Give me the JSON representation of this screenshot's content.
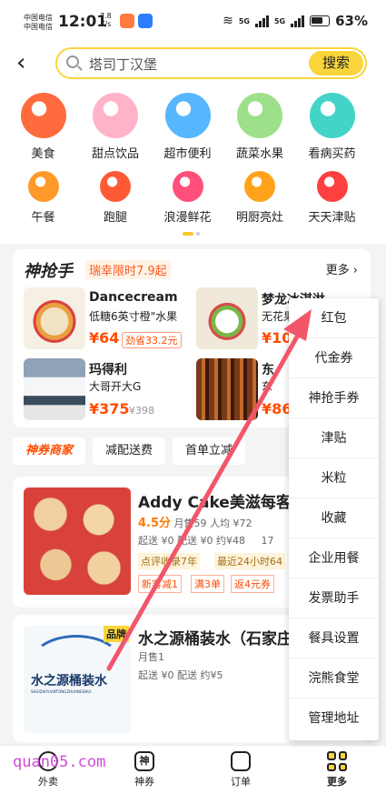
{
  "status": {
    "carrier_1": "中国电信",
    "carrier_2": "中国电信",
    "time": "12:01",
    "speed_value": "7.8",
    "speed_unit": "K/s",
    "net_1": "5G",
    "net_2": "5G",
    "battery": "63%"
  },
  "search": {
    "placeholder": "塔司丁汉堡",
    "button": "搜索"
  },
  "categories_row1": [
    {
      "label": "美食",
      "icon": "noodle-bowl-icon",
      "color": "#ff6b3d"
    },
    {
      "label": "甜点饮品",
      "icon": "cake-icon",
      "color": "#ffb3c8"
    },
    {
      "label": "超市便利",
      "icon": "shopping-basket-icon",
      "color": "#56b6ff"
    },
    {
      "label": "蔬菜水果",
      "icon": "peach-icon",
      "color": "#9ee08a"
    },
    {
      "label": "看病买药",
      "icon": "medicine-box-icon",
      "color": "#43d4c8"
    }
  ],
  "categories_row2": [
    {
      "label": "午餐",
      "icon": "lunch-bowl-icon",
      "color": "#ff9a2a"
    },
    {
      "label": "跑腿",
      "icon": "runner-icon",
      "color": "#ff5a36"
    },
    {
      "label": "浪漫鲜花",
      "icon": "flower-icon",
      "color": "#ff4f7a"
    },
    {
      "label": "明厨亮灶",
      "icon": "camera-icon",
      "color": "#ffa31a"
    },
    {
      "label": "天天津贴",
      "icon": "red-envelope-icon",
      "color": "#ff4040"
    }
  ],
  "flash_sale": {
    "title": "神抢手",
    "tag": "瑞幸限时7.9起",
    "more": "更多 ›",
    "deals": [
      {
        "name": "Dancecream",
        "sub": "低糖6英寸橙\"水果",
        "price": "¥64",
        "save": "劲省33.2元"
      },
      {
        "name": "梦龙冰淇淋",
        "sub": "无花果",
        "price": "¥10"
      },
      {
        "name": "玛得利",
        "sub": "大哥开大G",
        "price": "¥375",
        "old": "¥398"
      },
      {
        "name": "东",
        "sub": "东",
        "price": "¥86"
      }
    ]
  },
  "chips": [
    "神券商家",
    "减配送费",
    "首单立减"
  ],
  "shops": [
    {
      "name": "Addy Cake美滋每客",
      "rating": "4.5分",
      "sales": "月售59",
      "avg": "人均 ¥72",
      "delivery": "起送 ¥0  配送 ¥0  约¥48",
      "distance": "17",
      "tag_1": "点评收录7年",
      "tag_2": "最近24小时64",
      "promo_1": "新客减1",
      "promo_2": "满3单",
      "promo_3": "返4元券"
    },
    {
      "badge": "品牌",
      "name": "水之源桶装水（石家庄",
      "sales": "月售1",
      "delivery": "起送 ¥0  配送 约¥5",
      "logo_text": "水之源桶装水",
      "logo_sub": "SHUIZHIYUANTONGZHUANGSHUI"
    }
  ],
  "menu": [
    "红包",
    "代金券",
    "神抢手券",
    "津贴",
    "米粒",
    "收藏",
    "企业用餐",
    "发票助手",
    "餐具设置",
    "浣熊食堂",
    "管理地址"
  ],
  "tabbar": [
    {
      "label": "外卖",
      "icon": "takeout-icon"
    },
    {
      "label": "神券",
      "icon": "coupon-icon",
      "glyph": "神"
    },
    {
      "label": "订单",
      "icon": "order-icon"
    },
    {
      "label": "更多",
      "icon": "more-grid-icon"
    }
  ],
  "watermark": "quan05.com",
  "accent": "#f9d53b"
}
